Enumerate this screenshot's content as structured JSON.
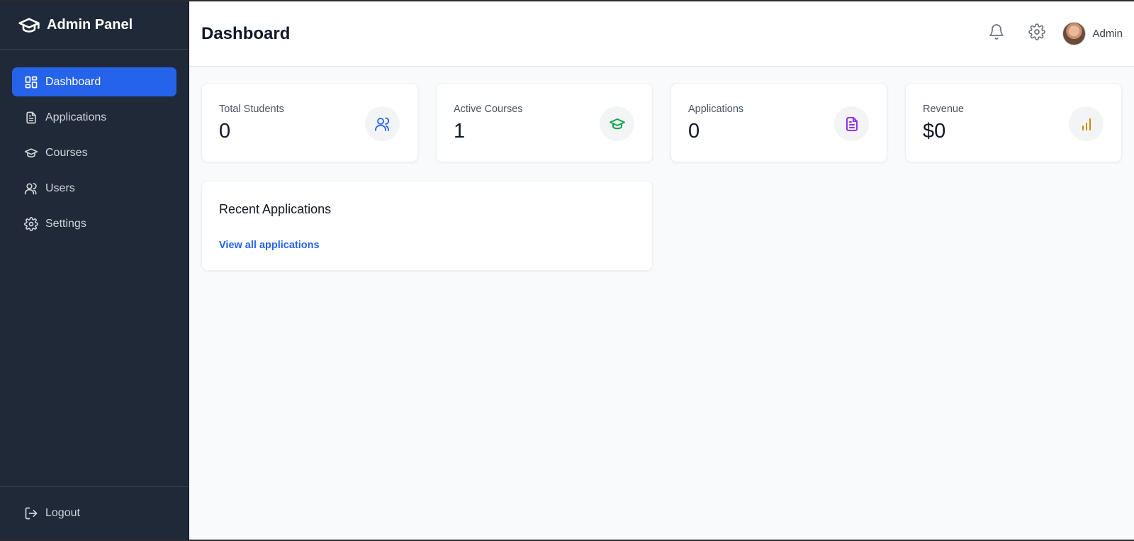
{
  "sidebar": {
    "brand": {
      "title": "Admin Panel",
      "icon": "graduation-cap-icon"
    },
    "items": [
      {
        "label": "Dashboard",
        "icon": "dashboard-grid-icon",
        "active": true
      },
      {
        "label": "Applications",
        "icon": "document-icon",
        "active": false
      },
      {
        "label": "Courses",
        "icon": "graduation-cap-icon",
        "active": false
      },
      {
        "label": "Users",
        "icon": "users-icon",
        "active": false
      },
      {
        "label": "Settings",
        "icon": "gear-icon",
        "active": false
      }
    ],
    "logout": {
      "label": "Logout",
      "icon": "logout-icon"
    }
  },
  "header": {
    "title": "Dashboard",
    "user_name": "Admin"
  },
  "stats": [
    {
      "label": "Total Students",
      "value": "0",
      "icon": "users-icon",
      "color": "#2563eb"
    },
    {
      "label": "Active Courses",
      "value": "1",
      "icon": "graduation-cap-icon",
      "color": "#16a34a"
    },
    {
      "label": "Applications",
      "value": "0",
      "icon": "document-icon",
      "color": "#9333ea"
    },
    {
      "label": "Revenue",
      "value": "$0",
      "icon": "bar-chart-icon",
      "color": "#ca8a04"
    }
  ],
  "recent": {
    "title": "Recent Applications",
    "link": "View all applications"
  },
  "colors": {
    "sidebar_bg": "#1f2937",
    "accent": "#2563eb",
    "page_bg": "#f8fafc"
  }
}
